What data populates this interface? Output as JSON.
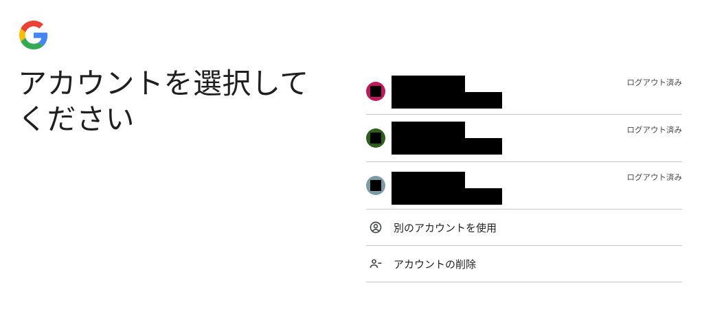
{
  "header": {
    "logo_icon": "google-g-logo",
    "title": "アカウントを選択して ください"
  },
  "colors": {
    "avatar1": "#c0185e",
    "avatar2": "#2e5f1b",
    "avatar3": "#7b9ca7",
    "divider": "#c4c7c5"
  },
  "accounts": [
    {
      "status": "ログアウト済み"
    },
    {
      "status": "ログアウト済み"
    },
    {
      "status": "ログアウト済み"
    }
  ],
  "actions": [
    {
      "label": "別のアカウントを使用",
      "icon": "account-circle-icon"
    },
    {
      "label": "アカウントの削除",
      "icon": "person-remove-icon"
    }
  ]
}
